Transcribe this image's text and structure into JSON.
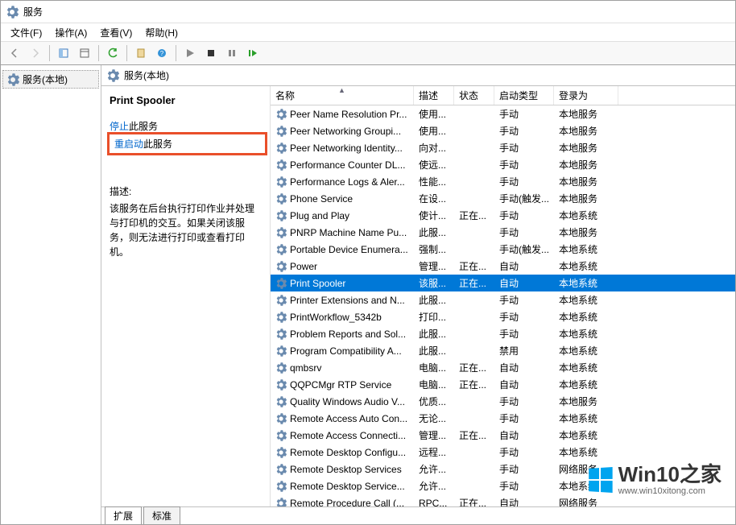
{
  "window": {
    "title": "服务"
  },
  "menu": {
    "file": "文件(F)",
    "action": "操作(A)",
    "view": "查看(V)",
    "help": "帮助(H)"
  },
  "tree": {
    "root": "服务(本地)"
  },
  "header": {
    "text": "服务(本地)"
  },
  "detail": {
    "title": "Print Spooler",
    "stop_link": "停止",
    "stop_suffix": "此服务",
    "restart_link": "重启动",
    "restart_suffix": "此服务",
    "desc_label": "描述:",
    "desc_text": "该服务在后台执行打印作业并处理与打印机的交互。如果关闭该服务，则无法进行打印或查看打印机。"
  },
  "columns": {
    "name": "名称",
    "desc": "描述",
    "status": "状态",
    "startup": "启动类型",
    "logon": "登录为"
  },
  "services": [
    {
      "name": "Peer Name Resolution Pr...",
      "desc": "使用...",
      "status": "",
      "startup": "手动",
      "logon": "本地服务"
    },
    {
      "name": "Peer Networking Groupi...",
      "desc": "使用...",
      "status": "",
      "startup": "手动",
      "logon": "本地服务"
    },
    {
      "name": "Peer Networking Identity...",
      "desc": "向对...",
      "status": "",
      "startup": "手动",
      "logon": "本地服务"
    },
    {
      "name": "Performance Counter DL...",
      "desc": "使远...",
      "status": "",
      "startup": "手动",
      "logon": "本地服务"
    },
    {
      "name": "Performance Logs & Aler...",
      "desc": "性能...",
      "status": "",
      "startup": "手动",
      "logon": "本地服务"
    },
    {
      "name": "Phone Service",
      "desc": "在设...",
      "status": "",
      "startup": "手动(触发...",
      "logon": "本地服务"
    },
    {
      "name": "Plug and Play",
      "desc": "使计...",
      "status": "正在...",
      "startup": "手动",
      "logon": "本地系统"
    },
    {
      "name": "PNRP Machine Name Pu...",
      "desc": "此服...",
      "status": "",
      "startup": "手动",
      "logon": "本地服务"
    },
    {
      "name": "Portable Device Enumera...",
      "desc": "强制...",
      "status": "",
      "startup": "手动(触发...",
      "logon": "本地系统"
    },
    {
      "name": "Power",
      "desc": "管理...",
      "status": "正在...",
      "startup": "自动",
      "logon": "本地系统"
    },
    {
      "name": "Print Spooler",
      "desc": "该服...",
      "status": "正在...",
      "startup": "自动",
      "logon": "本地系统",
      "selected": true
    },
    {
      "name": "Printer Extensions and N...",
      "desc": "此服...",
      "status": "",
      "startup": "手动",
      "logon": "本地系统"
    },
    {
      "name": "PrintWorkflow_5342b",
      "desc": "打印...",
      "status": "",
      "startup": "手动",
      "logon": "本地系统"
    },
    {
      "name": "Problem Reports and Sol...",
      "desc": "此服...",
      "status": "",
      "startup": "手动",
      "logon": "本地系统"
    },
    {
      "name": "Program Compatibility A...",
      "desc": "此服...",
      "status": "",
      "startup": "禁用",
      "logon": "本地系统"
    },
    {
      "name": "qmbsrv",
      "desc": "电脑...",
      "status": "正在...",
      "startup": "自动",
      "logon": "本地系统"
    },
    {
      "name": "QQPCMgr RTP Service",
      "desc": "电脑...",
      "status": "正在...",
      "startup": "自动",
      "logon": "本地系统"
    },
    {
      "name": "Quality Windows Audio V...",
      "desc": "优质...",
      "status": "",
      "startup": "手动",
      "logon": "本地服务"
    },
    {
      "name": "Remote Access Auto Con...",
      "desc": "无论...",
      "status": "",
      "startup": "手动",
      "logon": "本地系统"
    },
    {
      "name": "Remote Access Connecti...",
      "desc": "管理...",
      "status": "正在...",
      "startup": "自动",
      "logon": "本地系统"
    },
    {
      "name": "Remote Desktop Configu...",
      "desc": "远程...",
      "status": "",
      "startup": "手动",
      "logon": "本地系统"
    },
    {
      "name": "Remote Desktop Services",
      "desc": "允许...",
      "status": "",
      "startup": "手动",
      "logon": "网络服务"
    },
    {
      "name": "Remote Desktop Service...",
      "desc": "允许...",
      "status": "",
      "startup": "手动",
      "logon": "本地系统"
    },
    {
      "name": "Remote Procedure Call (...",
      "desc": "RPC...",
      "status": "正在...",
      "startup": "自动",
      "logon": "网络服务"
    }
  ],
  "tabs": {
    "extended": "扩展",
    "standard": "标准"
  },
  "watermark": {
    "brand": "Win10",
    "suffix": "之家",
    "url": "www.win10xitong.com"
  }
}
